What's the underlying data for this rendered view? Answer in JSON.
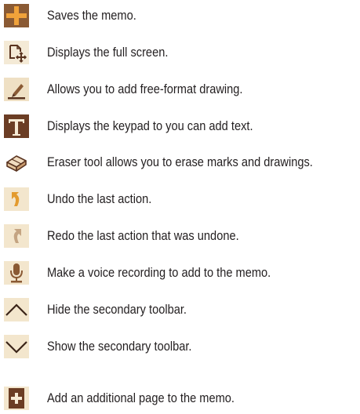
{
  "items": [
    {
      "icon": "plus-save-icon",
      "description": "Saves the memo."
    },
    {
      "icon": "fullscreen-icon",
      "description": "Displays the full screen."
    },
    {
      "icon": "pen-icon",
      "description": "Allows you to add free-format drawing."
    },
    {
      "icon": "text-icon",
      "description": "Displays the keypad to you can add text."
    },
    {
      "icon": "eraser-icon",
      "description": "Eraser tool allows you to erase marks and drawings."
    },
    {
      "icon": "undo-icon",
      "description": "Undo the last action."
    },
    {
      "icon": "redo-icon",
      "description": "Redo the last action that was undone."
    },
    {
      "icon": "microphone-icon",
      "description": "Make a voice recording to add to the memo."
    },
    {
      "icon": "chevron-up-icon",
      "description": "Hide the secondary toolbar."
    },
    {
      "icon": "chevron-down-icon",
      "description": "Show the secondary toolbar."
    },
    {
      "icon": "add-page-icon",
      "description": "Add an additional page to the memo."
    }
  ],
  "colors": {
    "icon_brown": "#8a5a34",
    "icon_dark": "#5a3420",
    "icon_tan": "#e6cfa6",
    "icon_orange": "#e39b2f",
    "icon_bg": "#f2e6cf",
    "text": "#231f20"
  }
}
